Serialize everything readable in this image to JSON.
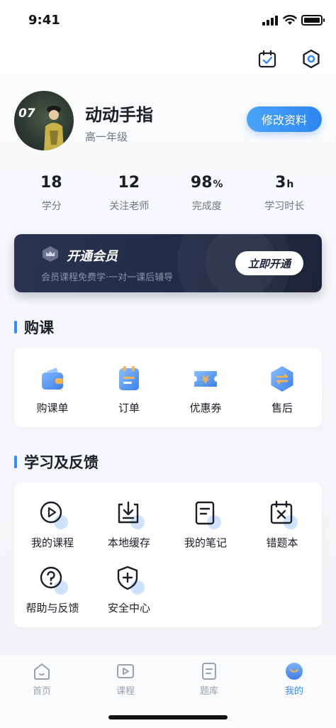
{
  "status_bar": {
    "time": "9:41"
  },
  "profile": {
    "avatar_badge": "07",
    "name": "动动手指",
    "grade": "高一年级",
    "edit_label": "修改资料"
  },
  "stats": [
    {
      "value": "18",
      "unit": "",
      "label": "学分"
    },
    {
      "value": "12",
      "unit": "",
      "label": "关注老师"
    },
    {
      "value": "98",
      "unit": "%",
      "label": "完成度"
    },
    {
      "value": "3",
      "unit": "h",
      "label": "学习时长"
    }
  ],
  "vip": {
    "title": "开通会员",
    "subtitle": "会员课程免费学·一对一课后辅导",
    "button_label": "立即开通"
  },
  "purchase": {
    "title": "购课",
    "items": [
      {
        "label": "购课单",
        "icon": "wallet-icon"
      },
      {
        "label": "订单",
        "icon": "order-icon"
      },
      {
        "label": "优惠券",
        "icon": "coupon-icon"
      },
      {
        "label": "售后",
        "icon": "after-sales-icon"
      }
    ]
  },
  "learning": {
    "title": "学习及反馈",
    "items": [
      {
        "label": "我的课程",
        "icon": "play-circle-icon"
      },
      {
        "label": "本地缓存",
        "icon": "download-icon"
      },
      {
        "label": "我的笔记",
        "icon": "note-icon"
      },
      {
        "label": "错题本",
        "icon": "calendar-x-icon"
      },
      {
        "label": "帮助与反馈",
        "icon": "help-icon"
      },
      {
        "label": "安全中心",
        "icon": "shield-plus-icon"
      }
    ]
  },
  "tabbar": {
    "items": [
      {
        "label": "首页",
        "icon": "home-icon"
      },
      {
        "label": "课程",
        "icon": "video-icon"
      },
      {
        "label": "题库",
        "icon": "question-bank-icon"
      },
      {
        "label": "我的",
        "icon": "profile-icon"
      }
    ],
    "active": "我的"
  },
  "colors": {
    "accent": "#3d8bf2",
    "vip_background": "#222b44"
  }
}
